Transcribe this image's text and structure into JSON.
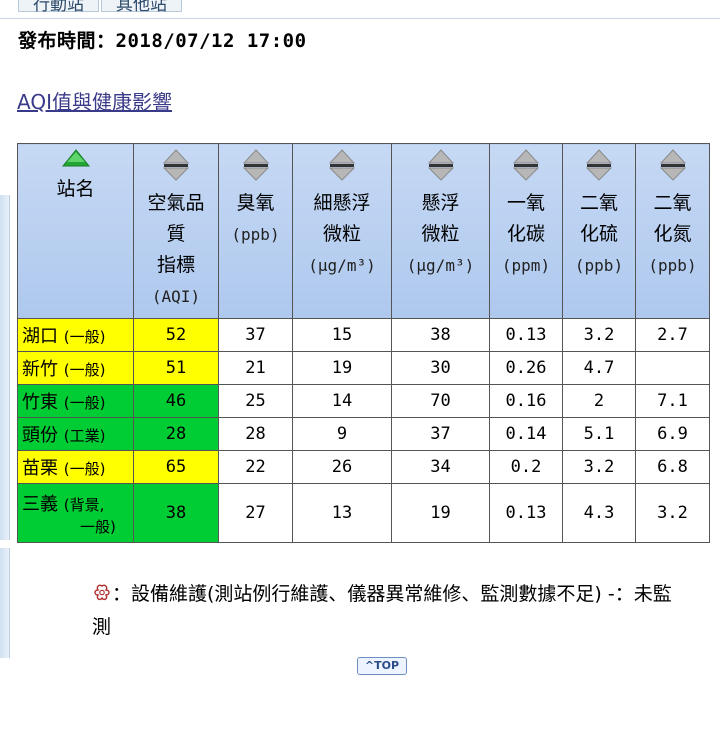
{
  "tabs": [
    "行動站",
    "其他站"
  ],
  "publish_label": "發布時間：",
  "publish_time": "2018/07/12 17:00",
  "aqi_link": "AQI值與健康影響",
  "colors": {
    "yellow": "#ffff00",
    "green": "#00cc33",
    "header_bg": "#b7cff1"
  },
  "table": {
    "headers": [
      {
        "lines": [
          "站名"
        ],
        "unit": "",
        "sort_icon": "sort-asc-active-icon"
      },
      {
        "lines": [
          "空氣品",
          "質",
          "指標"
        ],
        "unit": "(AQI)",
        "sort_icon": "sort-icon"
      },
      {
        "lines": [
          "臭氧"
        ],
        "unit": "(ppb)",
        "sort_icon": "sort-icon"
      },
      {
        "lines": [
          "細懸浮",
          "微粒"
        ],
        "unit": "(μg/m³)",
        "sort_icon": "sort-icon"
      },
      {
        "lines": [
          "懸浮",
          "微粒"
        ],
        "unit": "(μg/m³)",
        "sort_icon": "sort-icon"
      },
      {
        "lines": [
          "一氧",
          "化碳"
        ],
        "unit": "(ppm)",
        "sort_icon": "sort-icon"
      },
      {
        "lines": [
          "二氧",
          "化硫"
        ],
        "unit": "(ppb)",
        "sort_icon": "sort-icon"
      },
      {
        "lines": [
          "二氧",
          "化氮"
        ],
        "unit": "(ppb)",
        "sort_icon": "sort-icon"
      }
    ],
    "rows": [
      {
        "name": "湖口",
        "type": "(一般)",
        "aqi": "52",
        "aqi_level": "yellow",
        "o3": "37",
        "pm25": "15",
        "pm10": "38",
        "co": "0.13",
        "so2": "3.2",
        "no2": "2.7"
      },
      {
        "name": "新竹",
        "type": "(一般)",
        "aqi": "51",
        "aqi_level": "yellow",
        "o3": "21",
        "pm25": "19",
        "pm10": "30",
        "co": "0.26",
        "so2": "4.7",
        "no2": ""
      },
      {
        "name": "竹東",
        "type": "(一般)",
        "aqi": "46",
        "aqi_level": "green",
        "o3": "25",
        "pm25": "14",
        "pm10": "70",
        "co": "0.16",
        "so2": "2",
        "no2": "7.1"
      },
      {
        "name": "頭份",
        "type": "(工業)",
        "aqi": "28",
        "aqi_level": "green",
        "o3": "28",
        "pm25": "9",
        "pm10": "37",
        "co": "0.14",
        "so2": "5.1",
        "no2": "6.9"
      },
      {
        "name": "苗栗",
        "type": "(一般)",
        "aqi": "65",
        "aqi_level": "yellow",
        "o3": "22",
        "pm25": "26",
        "pm10": "34",
        "co": "0.2",
        "so2": "3.2",
        "no2": "6.8"
      },
      {
        "name": "三義",
        "type": "(背景,",
        "type2": "一般)",
        "aqi": "38",
        "aqi_level": "green",
        "o3": "27",
        "pm25": "13",
        "pm10": "19",
        "co": "0.13",
        "so2": "4.3",
        "no2": "3.2"
      }
    ]
  },
  "legend": {
    "maintenance_icon": "maintenance-icon",
    "text": "：設備維護(測站例行維護、儀器異常維修、監測數據不足) -：未監測"
  },
  "top_button": "^TOP"
}
